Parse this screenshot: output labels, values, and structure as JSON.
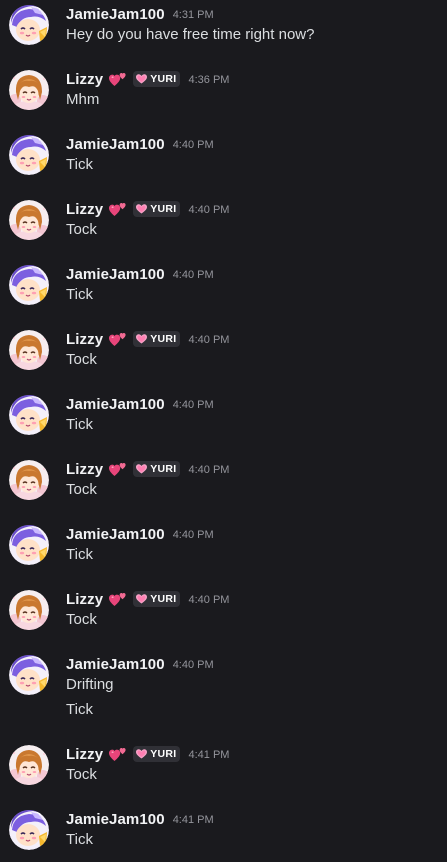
{
  "colors": {
    "background": "#1a1a1e",
    "username": "#f2f3f5",
    "message_text": "#dbdee1",
    "timestamp": "#94959c",
    "tag_background": "#303036",
    "heart_pink": "#e8457a"
  },
  "users": {
    "jamie": {
      "name": "JamieJam100",
      "avatar_icon": "anime-avatar-jamie-icon"
    },
    "lizzy": {
      "name": "Lizzy",
      "avatar_icon": "anime-avatar-lizzy-icon",
      "name_emoji_icon": "two-hearts-icon",
      "tag_icon": "pink-heart-icon",
      "tag": "YURI"
    }
  },
  "messages": [
    {
      "author": "jamie",
      "time": "4:31 PM",
      "lines": [
        "Hey do you have free time right now?"
      ]
    },
    {
      "author": "lizzy",
      "time": "4:36 PM",
      "lines": [
        "Mhm"
      ]
    },
    {
      "author": "jamie",
      "time": "4:40 PM",
      "lines": [
        "Tick"
      ]
    },
    {
      "author": "lizzy",
      "time": "4:40 PM",
      "lines": [
        "Tock"
      ]
    },
    {
      "author": "jamie",
      "time": "4:40 PM",
      "lines": [
        "Tick"
      ]
    },
    {
      "author": "lizzy",
      "time": "4:40 PM",
      "lines": [
        "Tock"
      ]
    },
    {
      "author": "jamie",
      "time": "4:40 PM",
      "lines": [
        "Tick"
      ]
    },
    {
      "author": "lizzy",
      "time": "4:40 PM",
      "lines": [
        "Tock"
      ]
    },
    {
      "author": "jamie",
      "time": "4:40 PM",
      "lines": [
        "Tick"
      ]
    },
    {
      "author": "lizzy",
      "time": "4:40 PM",
      "lines": [
        "Tock"
      ]
    },
    {
      "author": "jamie",
      "time": "4:40 PM",
      "lines": [
        "Drifting",
        "Tick"
      ]
    },
    {
      "author": "lizzy",
      "time": "4:41 PM",
      "lines": [
        "Tock"
      ]
    },
    {
      "author": "jamie",
      "time": "4:41 PM",
      "lines": [
        "Tick"
      ]
    }
  ]
}
